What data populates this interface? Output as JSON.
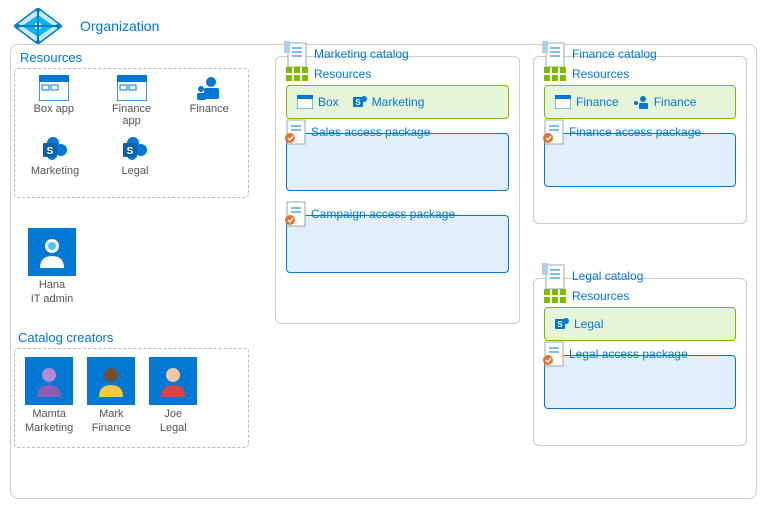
{
  "organization": {
    "label": "Organization"
  },
  "left": {
    "resources_title": "Resources",
    "resources": [
      {
        "name": "Box app",
        "icon": "app"
      },
      {
        "name": "Finance app",
        "icon": "app"
      },
      {
        "name": "Finance",
        "icon": "group"
      },
      {
        "name": "Marketing",
        "icon": "sharepoint"
      },
      {
        "name": "Legal",
        "icon": "sharepoint"
      }
    ],
    "admin": {
      "name": "Hana",
      "role": "IT admin"
    },
    "creators_title": "Catalog creators",
    "creators": [
      {
        "name": "Mamta",
        "role": "Marketing"
      },
      {
        "name": "Mark",
        "role": "Finance"
      },
      {
        "name": "Joe",
        "role": "Legal"
      }
    ]
  },
  "catalogs": {
    "marketing": {
      "title": "Marketing catalog",
      "resources_title": "Resources",
      "resources": [
        {
          "name": "Box",
          "icon": "app-small"
        },
        {
          "name": "Marketing",
          "icon": "sharepoint-small"
        }
      ],
      "packages": [
        {
          "title": "Sales access package"
        },
        {
          "title": "Campaign access package"
        }
      ]
    },
    "finance": {
      "title": "Finance catalog",
      "resources_title": "Resources",
      "resources": [
        {
          "name": "Finance",
          "icon": "app-small"
        },
        {
          "name": "Finance",
          "icon": "group-small"
        }
      ],
      "packages": [
        {
          "title": "Finance access package"
        }
      ]
    },
    "legal": {
      "title": "Legal catalog",
      "resources_title": "Resources",
      "resources": [
        {
          "name": "Legal",
          "icon": "sharepoint-small"
        }
      ],
      "packages": [
        {
          "title": "Legal access package"
        }
      ]
    }
  }
}
